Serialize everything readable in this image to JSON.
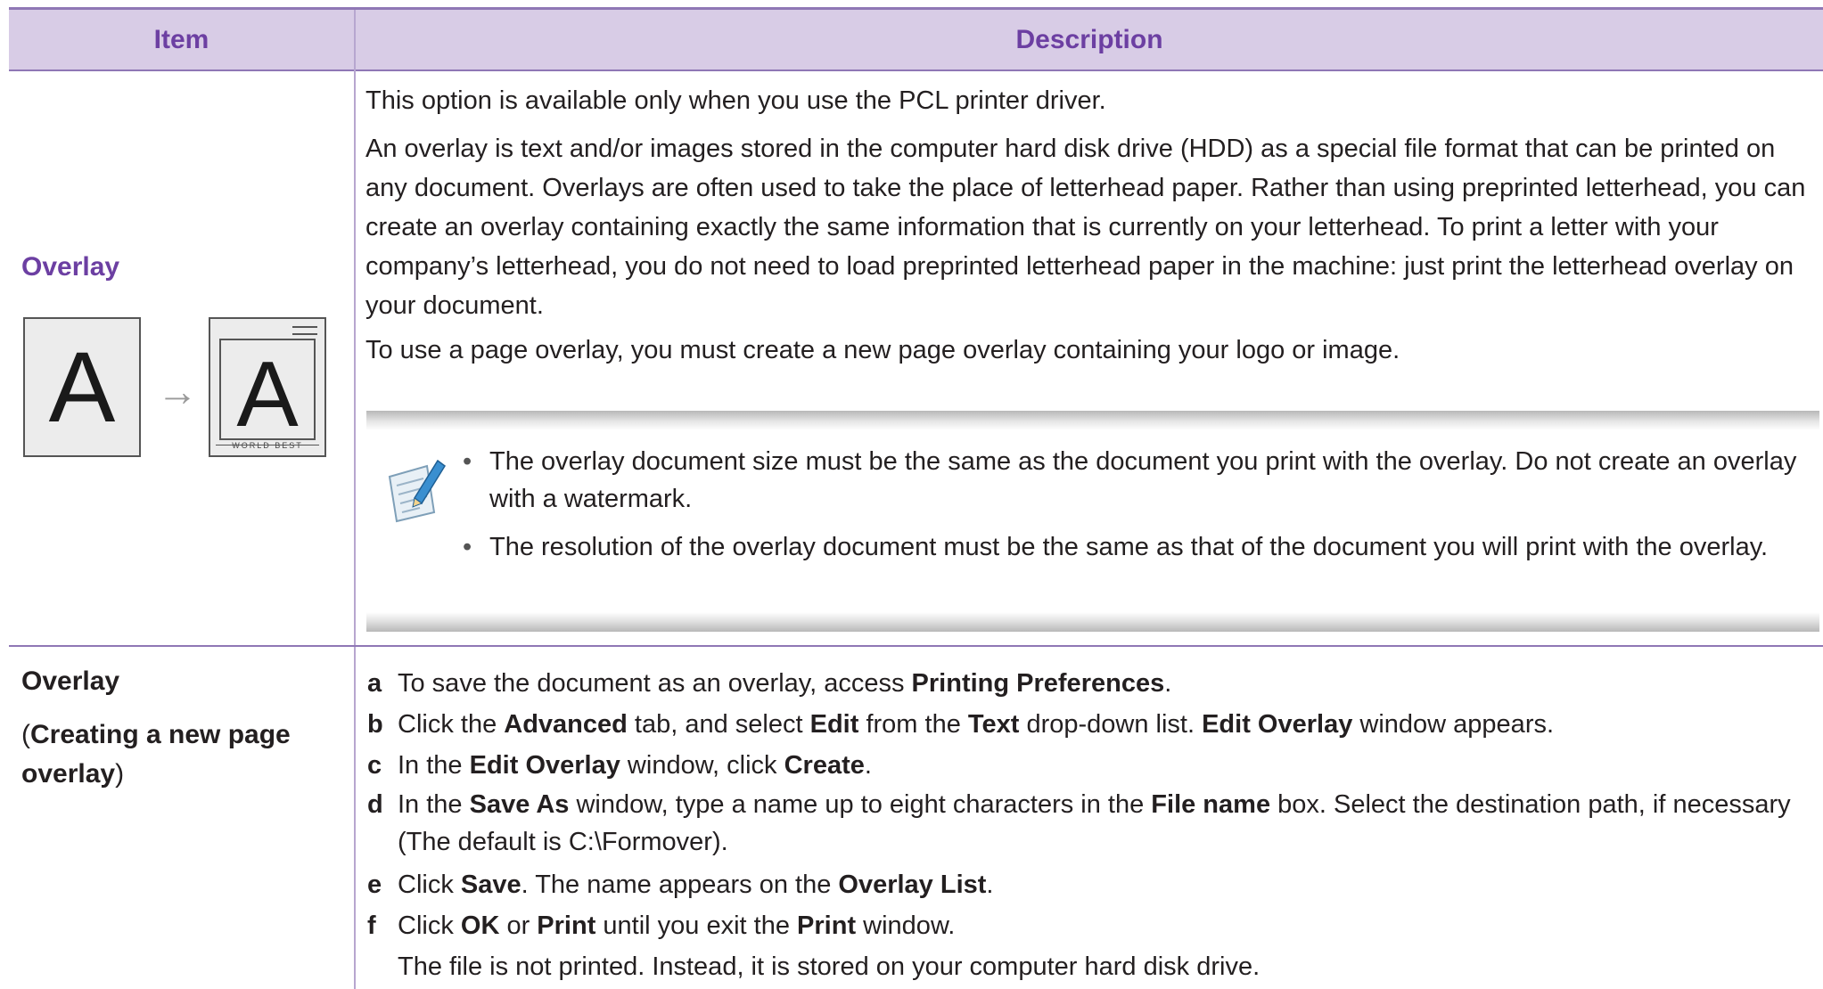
{
  "table": {
    "header": {
      "item": "Item",
      "description": "Description"
    },
    "row1": {
      "item_title": "Overlay",
      "figure": {
        "before_letter": "A",
        "arrow": "→",
        "after_letter": "A",
        "footer_text": "WORLD BEST"
      },
      "p1": "This option is available only when you use the PCL printer driver.",
      "p2": "An overlay is text and/or images stored in the computer hard disk drive (HDD) as a special file format that can be printed on any document. Overlays are often used to take the place of letterhead paper. Rather than using preprinted letterhead, you can create an overlay containing exactly the same information that is currently on your letterhead. To print a letter with your company’s letterhead, you do not need to load preprinted letterhead paper in the machine: just print the letterhead overlay on your document.",
      "p3": "To use a page overlay, you must create a new page overlay containing your logo or image.",
      "note": {
        "icon": "note-pencil-icon",
        "bullet": "•",
        "items": [
          "The overlay document size must be the same as the document you print with the overlay. Do not create an overlay with a watermark.",
          "The resolution of the overlay document must be the same as that of the document you will print with the overlay."
        ]
      }
    },
    "row2": {
      "item_title": "Overlay",
      "item_sub_open": "(",
      "item_sub_bold": "Creating a new page overlay",
      "item_sub_close": ")",
      "steps": {
        "a": {
          "letter": "a",
          "t1": "To save the document as an overlay, access ",
          "b1": "Printing Preferences",
          "t2": "."
        },
        "b": {
          "letter": "b",
          "t1": "Click the ",
          "b1": "Advanced",
          "t2": " tab, and select ",
          "b2": "Edit",
          "t3": " from the ",
          "b3": "Text",
          "t4": " drop-down list. ",
          "b4": "Edit Overlay",
          "t5": " window appears."
        },
        "c": {
          "letter": "c",
          "t1": "In the ",
          "b1": "Edit Overlay",
          "t2": " window, click ",
          "b2": "Create",
          "t3": "."
        },
        "d": {
          "letter": "d",
          "t1": "In the ",
          "b1": "Save As",
          "t2": " window, type a name up to eight characters in the ",
          "b2": "File name",
          "t3": " box. Select the destination path, if necessary (The default is C:\\Formover)."
        },
        "e": {
          "letter": "e",
          "t1": "Click ",
          "b1": "Save",
          "t2": ". The name appears on the ",
          "b2": "Overlay List",
          "t3": "."
        },
        "f": {
          "letter": "f",
          "t1": "Click ",
          "b1": "OK",
          "t2": " or ",
          "b2": "Print",
          "t3": " until you exit the ",
          "b3": "Print",
          "t4": " window.",
          "extra": "The file is not printed. Instead, it is stored on your computer hard disk drive."
        }
      }
    }
  },
  "colors": {
    "header_bg": "#d8cce6",
    "header_text": "#6c3fa2",
    "rule": "#8f77b5"
  }
}
